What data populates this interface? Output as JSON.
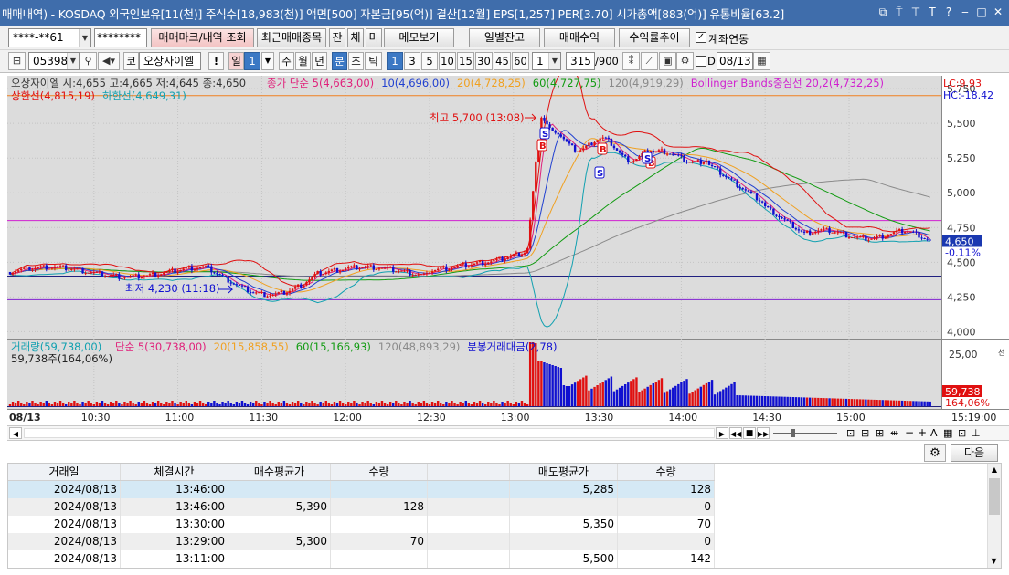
{
  "title": "매매내역) - KOSDAQ 외국인보유[11(천)] 주식수[18,983(천)] 액면[500] 자본금[95(억)] 결산[12월] EPS[1,257] PER[3.70] 시가총액[883(억)] 유통비율[63.2]",
  "window_icons": [
    "restore-icon",
    "pin-icon",
    "pin2-icon",
    "font-icon",
    "help-icon",
    "minimize-icon",
    "maximize-icon",
    "close-icon"
  ],
  "toolbar1": {
    "account": "****-**61",
    "password": "********",
    "btn_mark": "매매마크/내역 조회",
    "btn_recent": "최근매매종목",
    "tab_jan": "잔",
    "tab_che": "체",
    "tab_mi": "미",
    "btn_memo": "메모보기",
    "btn_daily": "일별잔고",
    "btn_profit": "매매수익",
    "btn_rate": "수익률추이",
    "chk_link": "계좌연동"
  },
  "toolbar2": {
    "code": "053980",
    "code_type": "코",
    "stock_name": "오상자이엘",
    "excl": "!",
    "day": "일",
    "day_num": "1",
    "week": "주",
    "month": "월",
    "year": "년",
    "min": "분",
    "sec": "초",
    "tick": "틱",
    "periods": [
      "1",
      "3",
      "5",
      "10",
      "15",
      "30",
      "45",
      "60"
    ],
    "custom": "1",
    "count": "315",
    "count_max": "/900",
    "checkbox_d": "D",
    "date": "08/13"
  },
  "chart_data": {
    "type": "candlestick",
    "stock": "오상자이엘",
    "ohlc_label": "오상자이엘 시:4,655 고:4,665 저:4,645 종:4,650",
    "upper_band_label": "상한선(4,815,19)",
    "lower_band_label": "하한선(4,649,31)",
    "ma_labels": [
      {
        "text": "종가 단순 5(4,663,00)",
        "color": "#e0207a"
      },
      {
        "text": "10(4,696,00)",
        "color": "#2040d0"
      },
      {
        "text": "20(4,728,25)",
        "color": "#f0a020"
      },
      {
        "text": "60(4,727,75)",
        "color": "#129b12"
      },
      {
        "text": "120(4,919,29)",
        "color": "#8a8a8a"
      },
      {
        "text": "Bollinger Bands중심선 20,2(4,732,25)",
        "color": "#d020d0"
      }
    ],
    "lc_label": "LC:9.93",
    "hc_label": "HC:-18.42",
    "high_label": "최고 5,700 (13:08)",
    "low_label": "최저 4,230 (11:18)",
    "price_axis": [
      "5,750",
      "5,500",
      "5,250",
      "5,000",
      "4,750",
      "4,500",
      "4,250",
      "4,000"
    ],
    "ylim": [
      3950,
      5810
    ],
    "current_price": "4,650",
    "current_change": "-0.11%",
    "volume_label": "거래량(59,738,00)",
    "vol_ma_labels": [
      {
        "text": "단순 5(30,738,00)",
        "color": "#e0207a"
      },
      {
        "text": "20(15,858,55)",
        "color": "#f0a020"
      },
      {
        "text": "60(15,166,93)",
        "color": "#129b12"
      },
      {
        "text": "120(48,893,29)",
        "color": "#8a8a8a"
      },
      {
        "text": "분봉거래대금(2,78)",
        "color": "#1010d0"
      }
    ],
    "volume_sub": "59,738주(164,06%)",
    "vol_axis": [
      "25,00",
      "0"
    ],
    "vol_unit": "천",
    "vol_current": "59,738",
    "vol_pct": "164,06%",
    "time_axis": [
      "08/13",
      "10:30",
      "11:00",
      "11:30",
      "12:00",
      "12:30",
      "13:00",
      "13:30",
      "14:00",
      "14:30",
      "15:00"
    ],
    "time_last": "15:19:00",
    "trade_marks": [
      {
        "time": "13:08",
        "type": "S"
      },
      {
        "time": "13:09",
        "type": "B"
      },
      {
        "time": "13:29",
        "type": "B"
      },
      {
        "time": "13:30",
        "type": "S"
      },
      {
        "time": "13:46",
        "type": "B"
      },
      {
        "time": "13:46",
        "type": "S"
      }
    ]
  },
  "bottom": {
    "next_btn": "다음"
  },
  "table": {
    "headers": [
      "거래일",
      "체결시간",
      "매수평균가",
      "수량",
      "",
      "매도평균가",
      "수량"
    ],
    "rows": [
      [
        "2024/08/13",
        "13:46:00",
        "",
        "",
        "",
        "5,285",
        "128"
      ],
      [
        "2024/08/13",
        "13:46:00",
        "5,390",
        "128",
        "",
        "",
        "0"
      ],
      [
        "2024/08/13",
        "13:30:00",
        "",
        "",
        "",
        "5,350",
        "70"
      ],
      [
        "2024/08/13",
        "13:29:00",
        "5,300",
        "70",
        "",
        "",
        "0"
      ],
      [
        "2024/08/13",
        "13:11:00",
        "",
        "",
        "",
        "5,500",
        "142"
      ]
    ]
  }
}
